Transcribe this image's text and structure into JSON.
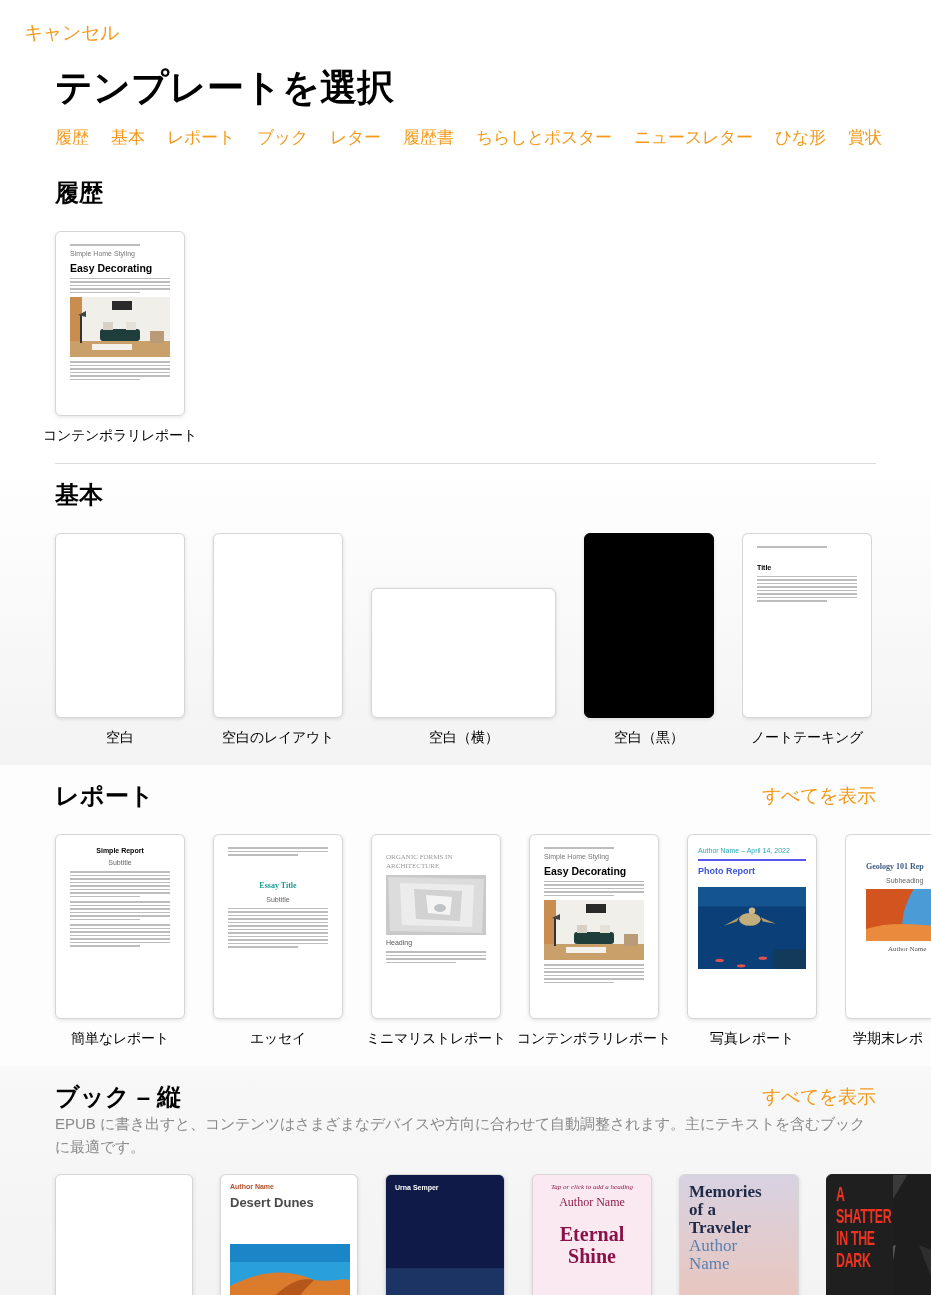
{
  "cancel": "キャンセル",
  "title": "テンプレートを選択",
  "tabs": [
    "履歴",
    "基本",
    "レポート",
    "ブック",
    "レター",
    "履歴書",
    "ちらしとポスター",
    "ニュースレター",
    "ひな形",
    "賞状"
  ],
  "sections": [
    {
      "heading": "履歴",
      "kind": "documents",
      "templates": [
        {
          "label": "コンテンポラリレポート",
          "thumb": {
            "kind": "article",
            "kicker": "Simple Home Styling",
            "title": "Easy Decorating"
          }
        }
      ]
    },
    {
      "heading": "基本",
      "kind": "documents",
      "templates": [
        {
          "label": "空白",
          "thumb": {
            "kind": "blank"
          }
        },
        {
          "label": "空白のレイアウト",
          "thumb": {
            "kind": "blank"
          }
        },
        {
          "label": "空白（横）",
          "thumb": {
            "kind": "landscape"
          }
        },
        {
          "label": "空白（黒）",
          "thumb": {
            "kind": "black"
          }
        },
        {
          "label": "ノートテーキング",
          "thumb": {
            "kind": "notes",
            "title": "Title"
          }
        }
      ]
    },
    {
      "heading": "レポート",
      "kind": "documents",
      "show_all": "すべてを表示",
      "templates": [
        {
          "label": "簡単なレポート",
          "thumb": {
            "kind": "simple",
            "title": "Simple Report",
            "subtitle": "Subtitle"
          }
        },
        {
          "label": "エッセイ",
          "thumb": {
            "kind": "essay",
            "title": "Essay Title",
            "subtitle": "Subtitle"
          }
        },
        {
          "label": "ミニマリストレポート",
          "thumb": {
            "kind": "minimal",
            "title": "ORGANIC FORMS IN ARCHITECTURE",
            "subtitle": "Heading"
          }
        },
        {
          "label": "コンテンポラリレポート",
          "thumb": {
            "kind": "article",
            "kicker": "Simple Home Styling",
            "title": "Easy Decorating"
          }
        },
        {
          "label": "写真レポート",
          "thumb": {
            "kicker": "Author Name – April 14, 2022",
            "title": "Photo Report"
          }
        },
        {
          "label": "学期末レポ",
          "thumb": {
            "kind": "geology",
            "title": "Geology 101 Rep",
            "subtitle": "Subheading",
            "author": "Author Name"
          }
        }
      ]
    },
    {
      "heading": "ブック – 縦",
      "kind": "books",
      "show_all": "すべてを表示",
      "description": "EPUB に書き出すと、コンテンツはさまざまなデバイスや方向に合わせて自動調整されます。主にテキストを含むブックに最適です。",
      "templates": [
        {
          "thumb": {
            "kind": "blank"
          }
        },
        {
          "thumb": {
            "kind": "dunes",
            "author": "Author Name",
            "title": "Desert Dunes"
          }
        },
        {
          "thumb": {
            "kind": "night",
            "title": "Urna Semper"
          }
        },
        {
          "thumb": {
            "kind": "pink",
            "kicker": "Tap or click to add a heading",
            "author": "Author Name",
            "title": "Eternal Shine"
          }
        },
        {
          "thumb": {
            "kind": "travel",
            "title": "Memories of a Traveler",
            "author": "Author Name"
          }
        },
        {
          "thumb": {
            "kind": "dark",
            "title": "A SHATTER IN THE DARK"
          }
        }
      ]
    }
  ]
}
